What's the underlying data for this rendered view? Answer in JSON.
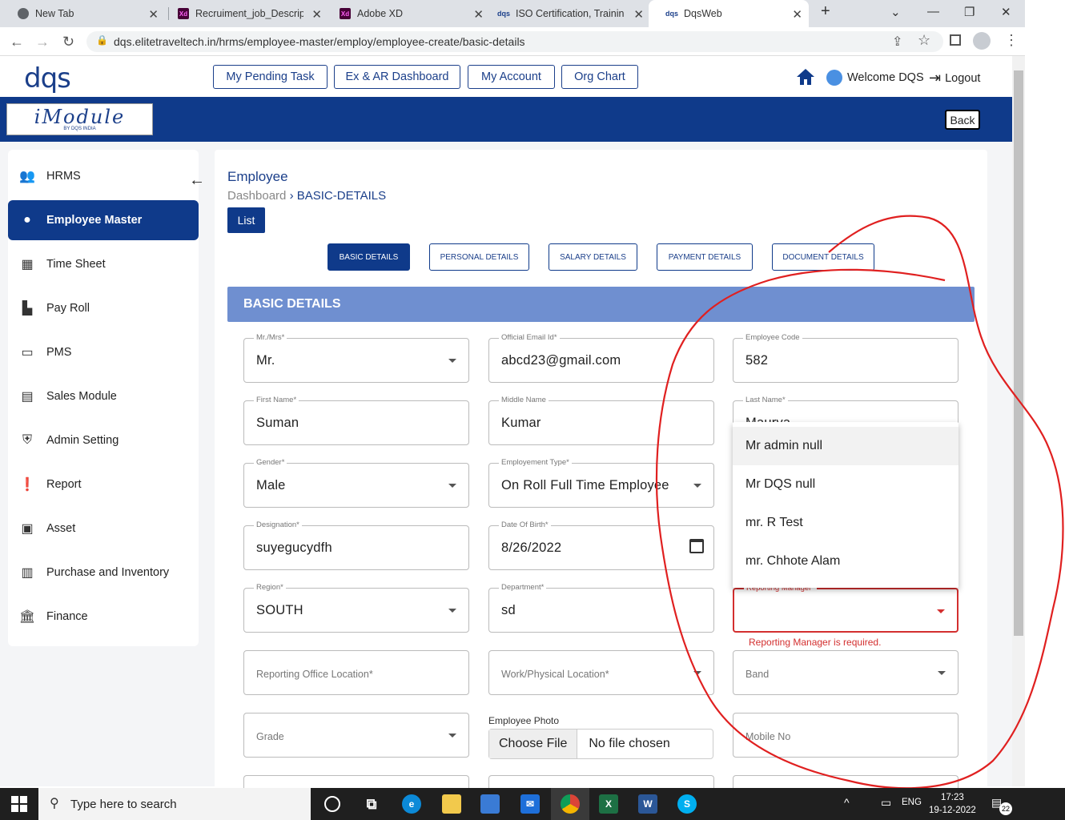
{
  "browser": {
    "tabs": [
      {
        "title": "New Tab",
        "icon": "chrome-icon"
      },
      {
        "title": "Recruiment_job_Descriptic",
        "icon": "adobe-xd-icon"
      },
      {
        "title": "Adobe XD",
        "icon": "adobe-xd-icon"
      },
      {
        "title": "ISO Certification, Training",
        "icon": "dqs-icon"
      },
      {
        "title": "DqsWeb",
        "icon": "dqs-icon"
      }
    ],
    "url": "dqs.elitetraveltech.in/hrms/employee-master/employ/employee-create/basic-details"
  },
  "header": {
    "logo": "dqs",
    "nav_buttons": [
      "My Pending Task",
      "Ex & AR Dashboard",
      "My Account",
      "Org Chart"
    ],
    "welcome": "Welcome DQS",
    "logout": "Logout",
    "brand_logo_text": "iModule",
    "brand_logo_sub": "BY DQS INDIA",
    "back": "Back"
  },
  "sidebar": {
    "items": [
      {
        "label": "HRMS",
        "icon": "people-icon"
      },
      {
        "label": "Employee Master",
        "icon": "person-icon",
        "active": true
      },
      {
        "label": "Time Sheet",
        "icon": "calendar-icon"
      },
      {
        "label": "Pay Roll",
        "icon": "payroll-icon"
      },
      {
        "label": "PMS",
        "icon": "devices-icon"
      },
      {
        "label": "Sales Module",
        "icon": "cash-register-icon"
      },
      {
        "label": "Admin Setting",
        "icon": "admin-shield-icon"
      },
      {
        "label": "Report",
        "icon": "alert-icon"
      },
      {
        "label": "Asset",
        "icon": "window-icon"
      },
      {
        "label": "Purchase and Inventory",
        "icon": "archive-icon"
      },
      {
        "label": "Finance",
        "icon": "bank-icon"
      }
    ]
  },
  "main": {
    "title": "Employee",
    "breadcrumb_root": "Dashboard",
    "breadcrumb_current": "BASIC-DETAILS",
    "list_button": "List",
    "step_tabs": [
      "BASIC DETAILS",
      "PERSONAL DETAILS",
      "SALARY DETAILS",
      "PAYMENT DETAILS",
      "DOCUMENT DETAILS"
    ],
    "section_title": "BASIC DETAILS",
    "fields": {
      "salutation": {
        "label": "Mr./Mrs",
        "value": "Mr."
      },
      "official_email": {
        "label": "Official Email Id",
        "value": "abcd23@gmail.com"
      },
      "employee_code": {
        "label": "Employee Code",
        "value": "582"
      },
      "first_name": {
        "label": "First Name",
        "value": "Suman"
      },
      "middle_name": {
        "label": "Middle Name",
        "value": "Kumar"
      },
      "last_name": {
        "label": "Last Name",
        "value": "Maurya"
      },
      "gender": {
        "label": "Gender",
        "value": "Male"
      },
      "employment_type": {
        "label": "Employement Type",
        "value": "On Roll Full Time Employee"
      },
      "designation": {
        "label": "Designation",
        "value": "suyegucydfh"
      },
      "dob": {
        "label": "Date Of Birth",
        "value": "8/26/2022"
      },
      "region": {
        "label": "Region",
        "value": "SOUTH"
      },
      "department": {
        "label": "Department",
        "value": "sd"
      },
      "reporting_manager": {
        "label": "Reporting Manager",
        "value": "",
        "error": "Reporting Manager is required."
      },
      "reporting_office": {
        "placeholder": "Reporting Office Location"
      },
      "work_location": {
        "placeholder": "Work/Physical Location"
      },
      "band": {
        "placeholder": "Band"
      },
      "grade": {
        "placeholder": "Grade"
      },
      "employee_photo": {
        "label": "Employee Photo",
        "button": "Choose File",
        "status": "No file chosen"
      },
      "mobile": {
        "placeholder": "Mobile No"
      }
    },
    "manager_options": [
      "Mr admin null",
      "Mr DQS null",
      "mr. R Test",
      "mr. Chhote Alam"
    ]
  },
  "taskbar": {
    "search_placeholder": "Type here to search",
    "lang": "ENG",
    "time": "17:23",
    "date": "19-12-2022",
    "notifications": "22"
  },
  "colors": {
    "brand": "#0f3a8a",
    "section_header": "#6f8fd0",
    "error": "#d32f2f",
    "annotation": "#e02020"
  }
}
